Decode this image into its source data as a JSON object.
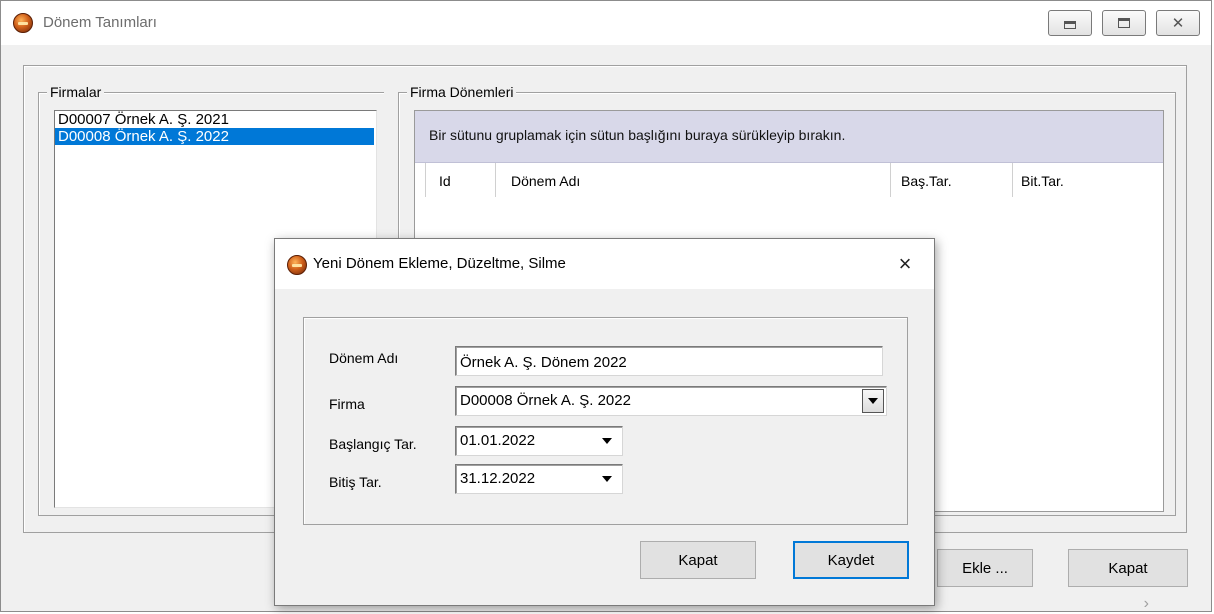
{
  "main_window": {
    "title": "Dönem Tanımları",
    "icon": "app-logo-icon"
  },
  "firmalar": {
    "legend": "Firmalar",
    "items": [
      {
        "label": "D00007  Örnek A. Ş. 2021",
        "selected": false
      },
      {
        "label": "D00008  Örnek A. Ş. 2022",
        "selected": true
      }
    ]
  },
  "donemler": {
    "legend": "Firma Dönemleri",
    "group_hint": "Bir sütunu gruplamak için sütun başlığını buraya sürükleyip bırakın.",
    "columns": [
      "Id",
      "Dönem Adı",
      "Baş.Tar.",
      "Bit.Tar."
    ]
  },
  "main_buttons": {
    "add": "Ekle ...",
    "close": "Kapat"
  },
  "dialog": {
    "title": "Yeni Dönem Ekleme, Düzeltme, Silme",
    "close_icon": "×",
    "fields": {
      "donem_adi": {
        "label": "Dönem Adı",
        "value": "Örnek A. Ş. Dönem 2022"
      },
      "firma": {
        "label": "Firma",
        "value": "D00008  Örnek A. Ş. 2022"
      },
      "baslangic": {
        "label": "Başlangıç Tar.",
        "value": "01.01.2022"
      },
      "bitis": {
        "label": "Bitiş Tar.",
        "value": "31.12.2022"
      }
    },
    "buttons": {
      "close": "Kapat",
      "save": "Kaydet"
    }
  },
  "colors": {
    "selection": "#0078d7",
    "group_panel": "#d8d8e9",
    "window_bg": "#f0f0f0"
  }
}
